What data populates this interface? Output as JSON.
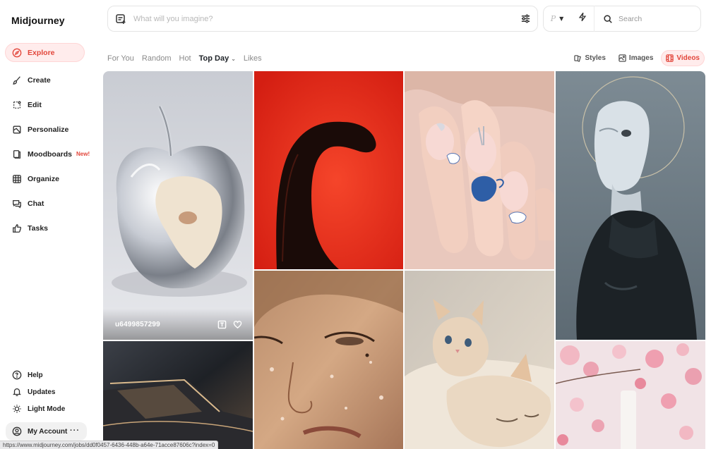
{
  "app": {
    "name": "Midjourney"
  },
  "sidebar": {
    "items": [
      {
        "label": "Explore",
        "icon": "compass-icon",
        "active": true
      },
      {
        "label": "Create",
        "icon": "brush-icon"
      },
      {
        "label": "Edit",
        "icon": "edit-icon"
      },
      {
        "label": "Personalize",
        "icon": "personalize-icon"
      },
      {
        "label": "Moodboards",
        "icon": "moodboard-icon",
        "badge": "New!"
      },
      {
        "label": "Organize",
        "icon": "grid-icon"
      },
      {
        "label": "Chat",
        "icon": "chat-icon"
      },
      {
        "label": "Tasks",
        "icon": "thumbs-up-icon"
      }
    ],
    "bottom": [
      {
        "label": "Help",
        "icon": "help-icon"
      },
      {
        "label": "Updates",
        "icon": "bell-icon"
      },
      {
        "label": "Light Mode",
        "icon": "sun-icon"
      }
    ],
    "account": {
      "label": "My Account",
      "menu": "···"
    }
  },
  "prompt": {
    "placeholder": "What will you imagine?"
  },
  "controls": {
    "p_label": "P",
    "search_placeholder": "Search"
  },
  "tabs": [
    {
      "label": "For You"
    },
    {
      "label": "Random"
    },
    {
      "label": "Hot"
    },
    {
      "label": "Top Day",
      "active": true,
      "dropdown": true
    },
    {
      "label": "Likes"
    }
  ],
  "views": [
    {
      "label": "Styles",
      "icon": "styles-icon"
    },
    {
      "label": "Images",
      "icon": "images-icon"
    },
    {
      "label": "Videos",
      "icon": "videos-icon",
      "active": true
    }
  ],
  "feed": {
    "hovered_tile": {
      "user": "u6499857299"
    }
  },
  "colors": {
    "accent": "#e2463b",
    "accent_bg": "#ffecec"
  },
  "status_bar": {
    "url": "https://www.midjourney.com/jobs/dd0f0457-6436-448b-a64e-71acce87606c?index=0"
  }
}
